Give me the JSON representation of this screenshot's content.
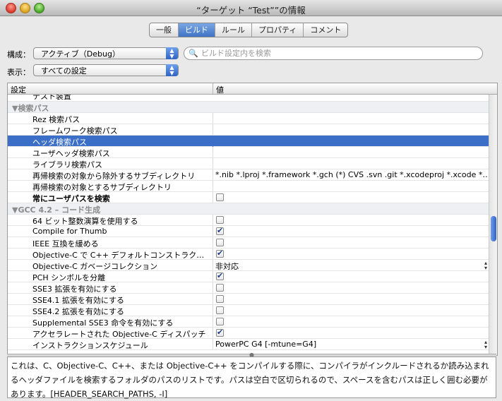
{
  "window": {
    "title": "“ターゲット “Test””の情報"
  },
  "tabs": [
    "一般",
    "ビルド",
    "ルール",
    "プロパティ",
    "コメント"
  ],
  "active_tab": 1,
  "config": {
    "label": "構成：",
    "value": "アクティブ（Debug）"
  },
  "show": {
    "label": "表示：",
    "value": "すべての設定"
  },
  "search": {
    "placeholder": "ビルド設定内を検索"
  },
  "table": {
    "headers": {
      "setting": "設定",
      "value": "値"
    },
    "partial_row": "テスト装置",
    "rows": [
      {
        "type": "group",
        "label": "▼検索パス"
      },
      {
        "label": "Rez 検索パス"
      },
      {
        "label": "フレームワーク検索パス"
      },
      {
        "label": "ヘッダ検索パス",
        "selected": true
      },
      {
        "label": "ユーザヘッダ検索パス"
      },
      {
        "label": "ライブラリ検索パス"
      },
      {
        "label": "再帰検索の対象から除外するサブディレクトリ",
        "value": "*.nib *.lproj *.framework *.gch (*) CVS .svn .git *.xcodeproj *.xcode *…"
      },
      {
        "label": "再帰検索の対象とするサブディレクトリ"
      },
      {
        "label": "常にユーザパスを検索",
        "bold": true,
        "checkbox": false
      },
      {
        "type": "group",
        "label": "▼GCC 4.2 – コード生成"
      },
      {
        "label": "64 ビット整数演算を使用する",
        "checkbox": false
      },
      {
        "label": "Compile for Thumb",
        "checkbox": true
      },
      {
        "label": "IEEE 互換を緩める",
        "checkbox": false
      },
      {
        "label": "Objective-C で C++ デフォルトコンストラク…",
        "checkbox": true
      },
      {
        "label": "Objective-C ガベージコレクション",
        "value": "非対応",
        "popup": true
      },
      {
        "label": "PCH シンボルを分離",
        "checkbox": true
      },
      {
        "label": "SSE3 拡張を有効にする",
        "checkbox": false
      },
      {
        "label": "SSE4.1 拡張を有効にする",
        "checkbox": false
      },
      {
        "label": "SSE4.2 拡張を有効にする",
        "checkbox": false
      },
      {
        "label": "Supplemental SSE3 命令を有効にする",
        "checkbox": false
      },
      {
        "label": "アクセラレートされた Objective-C ディスパッチ",
        "checkbox": true
      },
      {
        "label": "インストラクションスケジュール",
        "value": "PowerPC G4 [-mtune=G4]",
        "popup": true
      }
    ]
  },
  "description": "これは、C、Objective-C、C++、または Objective-C++ をコンパイルする際に、コンパイラがインクルードされるか読み込まれるヘッダファイルを検索するフォルダのパスのリストです。パスは空白で区切られるので、スペースを含むパスは正しく囲む必要があります。[HEADER_SEARCH_PATHS, -I]",
  "colors": {
    "selection": "#3b6fc7",
    "accent": "#2f63c8"
  }
}
